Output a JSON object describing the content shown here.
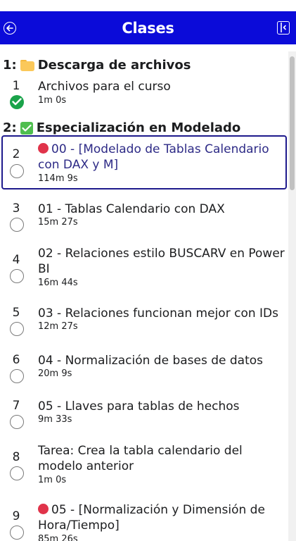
{
  "header": {
    "title": "Clases"
  },
  "sections": [
    {
      "number": "1:",
      "title": "Descarga de archivos",
      "icon": "folder-icon"
    },
    {
      "number": "2:",
      "title": "Especialización en Modelado",
      "icon": "checkbox-icon"
    }
  ],
  "lectures": [
    {
      "index": "1",
      "title": "Archivos para el curso",
      "duration": "1m 0s",
      "status": "complete"
    },
    {
      "index": "2",
      "title": "00 - [Modelado de Tablas Calendario con DAX y M]",
      "duration": "114m 9s",
      "status": "incomplete",
      "live": true,
      "current": true
    },
    {
      "index": "3",
      "title": "01 - Tablas Calendario con DAX",
      "duration": "15m 27s",
      "status": "incomplete"
    },
    {
      "index": "4",
      "title": "02 - Relaciones estilo BUSCARV en Power BI",
      "duration": "16m 44s",
      "status": "incomplete"
    },
    {
      "index": "5",
      "title": "03 - Relaciones funcionan mejor con IDs",
      "duration": "12m 27s",
      "status": "incomplete"
    },
    {
      "index": "6",
      "title": "04 - Normalización de bases de datos",
      "duration": "20m 9s",
      "status": "incomplete"
    },
    {
      "index": "7",
      "title": "05 - Llaves para tablas de hechos",
      "duration": "9m 33s",
      "status": "incomplete"
    },
    {
      "index": "8",
      "title": "Tarea: Crea la tabla calendario del modelo anterior",
      "duration": "1m 0s",
      "status": "incomplete"
    },
    {
      "index": "9",
      "title": "05 - [Normalización y Dimensión de Hora/Tiempo]",
      "duration": "85m 26s",
      "status": "incomplete",
      "live": true
    }
  ]
}
